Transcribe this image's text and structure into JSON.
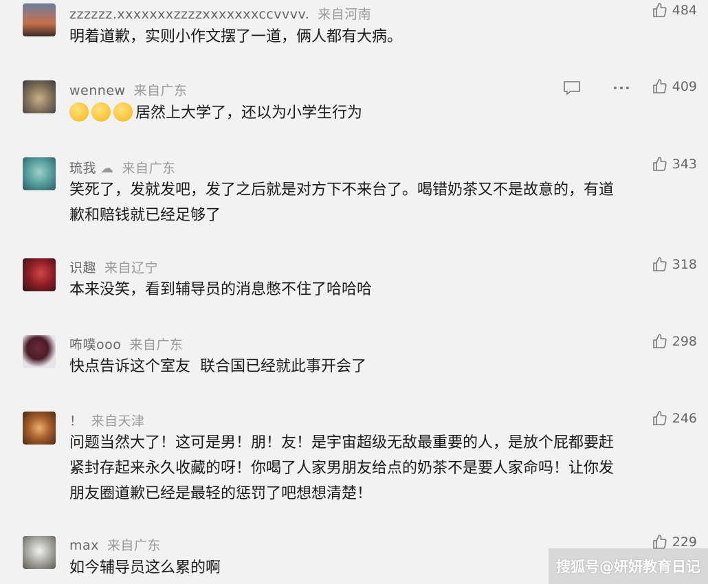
{
  "comments": [
    {
      "user": "zzzzzz.xxxxxxxzzzzxxxxxxxccvvvv.",
      "location": "来自河南",
      "likes": "484",
      "lines": [
        "明着道歉，实则小作文摆了一道，俩人都有大病。"
      ]
    },
    {
      "user": "wennew",
      "location": "来自广东",
      "likes": "409",
      "lines": [
        "居然上大学了，还以为小学生行为"
      ]
    },
    {
      "user": "琉我",
      "location": "来自广东",
      "likes": "343",
      "lines": [
        "笑死了，发就发吧，发了之后就是对方下不来台了。喝错奶茶又不是故意的，有道",
        "歉和赔钱就已经足够了"
      ]
    },
    {
      "user": "识趣",
      "location": "来自辽宁",
      "likes": "318",
      "lines": [
        "本来没笑，看到辅导员的消息憋不住了哈哈哈"
      ]
    },
    {
      "user": "咘噗ooo",
      "location": "来自广东",
      "likes": "298",
      "lines": [
        "快点告诉这个室友  联合国已经就此事开会了"
      ]
    },
    {
      "user": "！",
      "location": "来自天津",
      "likes": "246",
      "lines": [
        "问题当然大了！这可是男！朋！友！是宇宙超级无敌最重要的人，是放个屁都要赶",
        "紧封存起来永久收藏的呀！你喝了人家男朋友给点的奶茶不是要人家命吗！让你发",
        "朋友圈道歉已经是最轻的惩罚了吧想想清楚！"
      ]
    },
    {
      "user": "max",
      "location": "来自广东",
      "likes": "229",
      "lines": [
        "如今辅导员这么累的啊"
      ]
    }
  ],
  "watermark": "搜狐号@妍妍教育日记",
  "colors": {
    "background": "#f2f2f2",
    "text": "#1a1a1a",
    "meta": "#999999"
  }
}
